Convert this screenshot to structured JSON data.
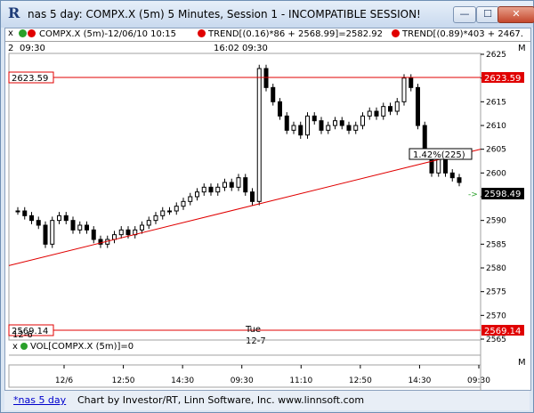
{
  "window": {
    "title": "nas 5 day: COMPX.X (5m) 5 Minutes, Session 1 - INCOMPATIBLE SESSION!",
    "app_icon": "R",
    "buttons": {
      "minimize": "—",
      "maximize": "☐",
      "close": "✕"
    }
  },
  "legend": {
    "close_btn": "x",
    "series": "COMPX.X (5m)-12/06/10 10:15",
    "trend1": "TREND[(0.16)*86 + 2568.99]=2582.92",
    "trend2": "TREND[(0.89)*403 + 2467."
  },
  "chart_header": {
    "left_num": "2",
    "left_time": "09:30",
    "mid_time": "16:02",
    "mid_time2": "09:30",
    "m_btn": "M"
  },
  "levels": {
    "top": "2623.59",
    "bottom": "2569.14",
    "last": "2598.49"
  },
  "annotations": {
    "pct": "1.42%(225)",
    "date1_line1": "12-6",
    "date2_line1": "Tue",
    "date2_line2": "12-7",
    "arrow": "->"
  },
  "chart_data": {
    "type": "line",
    "title": "",
    "y_ticks": [
      "2625",
      "2620",
      "2615",
      "2610",
      "2605",
      "2600",
      "2595",
      "2590",
      "2585",
      "2580",
      "2575",
      "2570",
      "2565"
    ],
    "ylim": [
      2565,
      2625
    ],
    "x_ticks": [
      "12/6",
      "12:50",
      "14:30",
      "09:30",
      "11:10",
      "12:50",
      "14:30",
      "09:30"
    ],
    "series": [
      {
        "values": [
          2592,
          2591,
          2590,
          2589,
          2585,
          2590,
          2591,
          2590,
          2588,
          2589,
          2588,
          2586,
          2585,
          2586,
          2587,
          2588,
          2587,
          2588,
          2589,
          2590,
          2591,
          2592,
          2592,
          2593,
          2594,
          2595,
          2596,
          2597,
          2596,
          2597,
          2598,
          2597,
          2599,
          2596,
          2594,
          2622,
          2618,
          2615,
          2612,
          2609,
          2610,
          2608,
          2612,
          2611,
          2609,
          2610,
          2611,
          2610,
          2609,
          2610,
          2612,
          2613,
          2612,
          2614,
          2613,
          2615,
          2620,
          2618,
          2610,
          2604,
          2600,
          2604,
          2600,
          2599,
          2598
        ]
      }
    ],
    "trend_lines": [
      {
        "name": "TREND1",
        "start": 2580.5,
        "end": 2605
      }
    ],
    "volume_label": "VOL[COMPX.X (5m)]=0"
  },
  "colors": {
    "line_red": "#e00000",
    "candle": "#000000"
  }
}
